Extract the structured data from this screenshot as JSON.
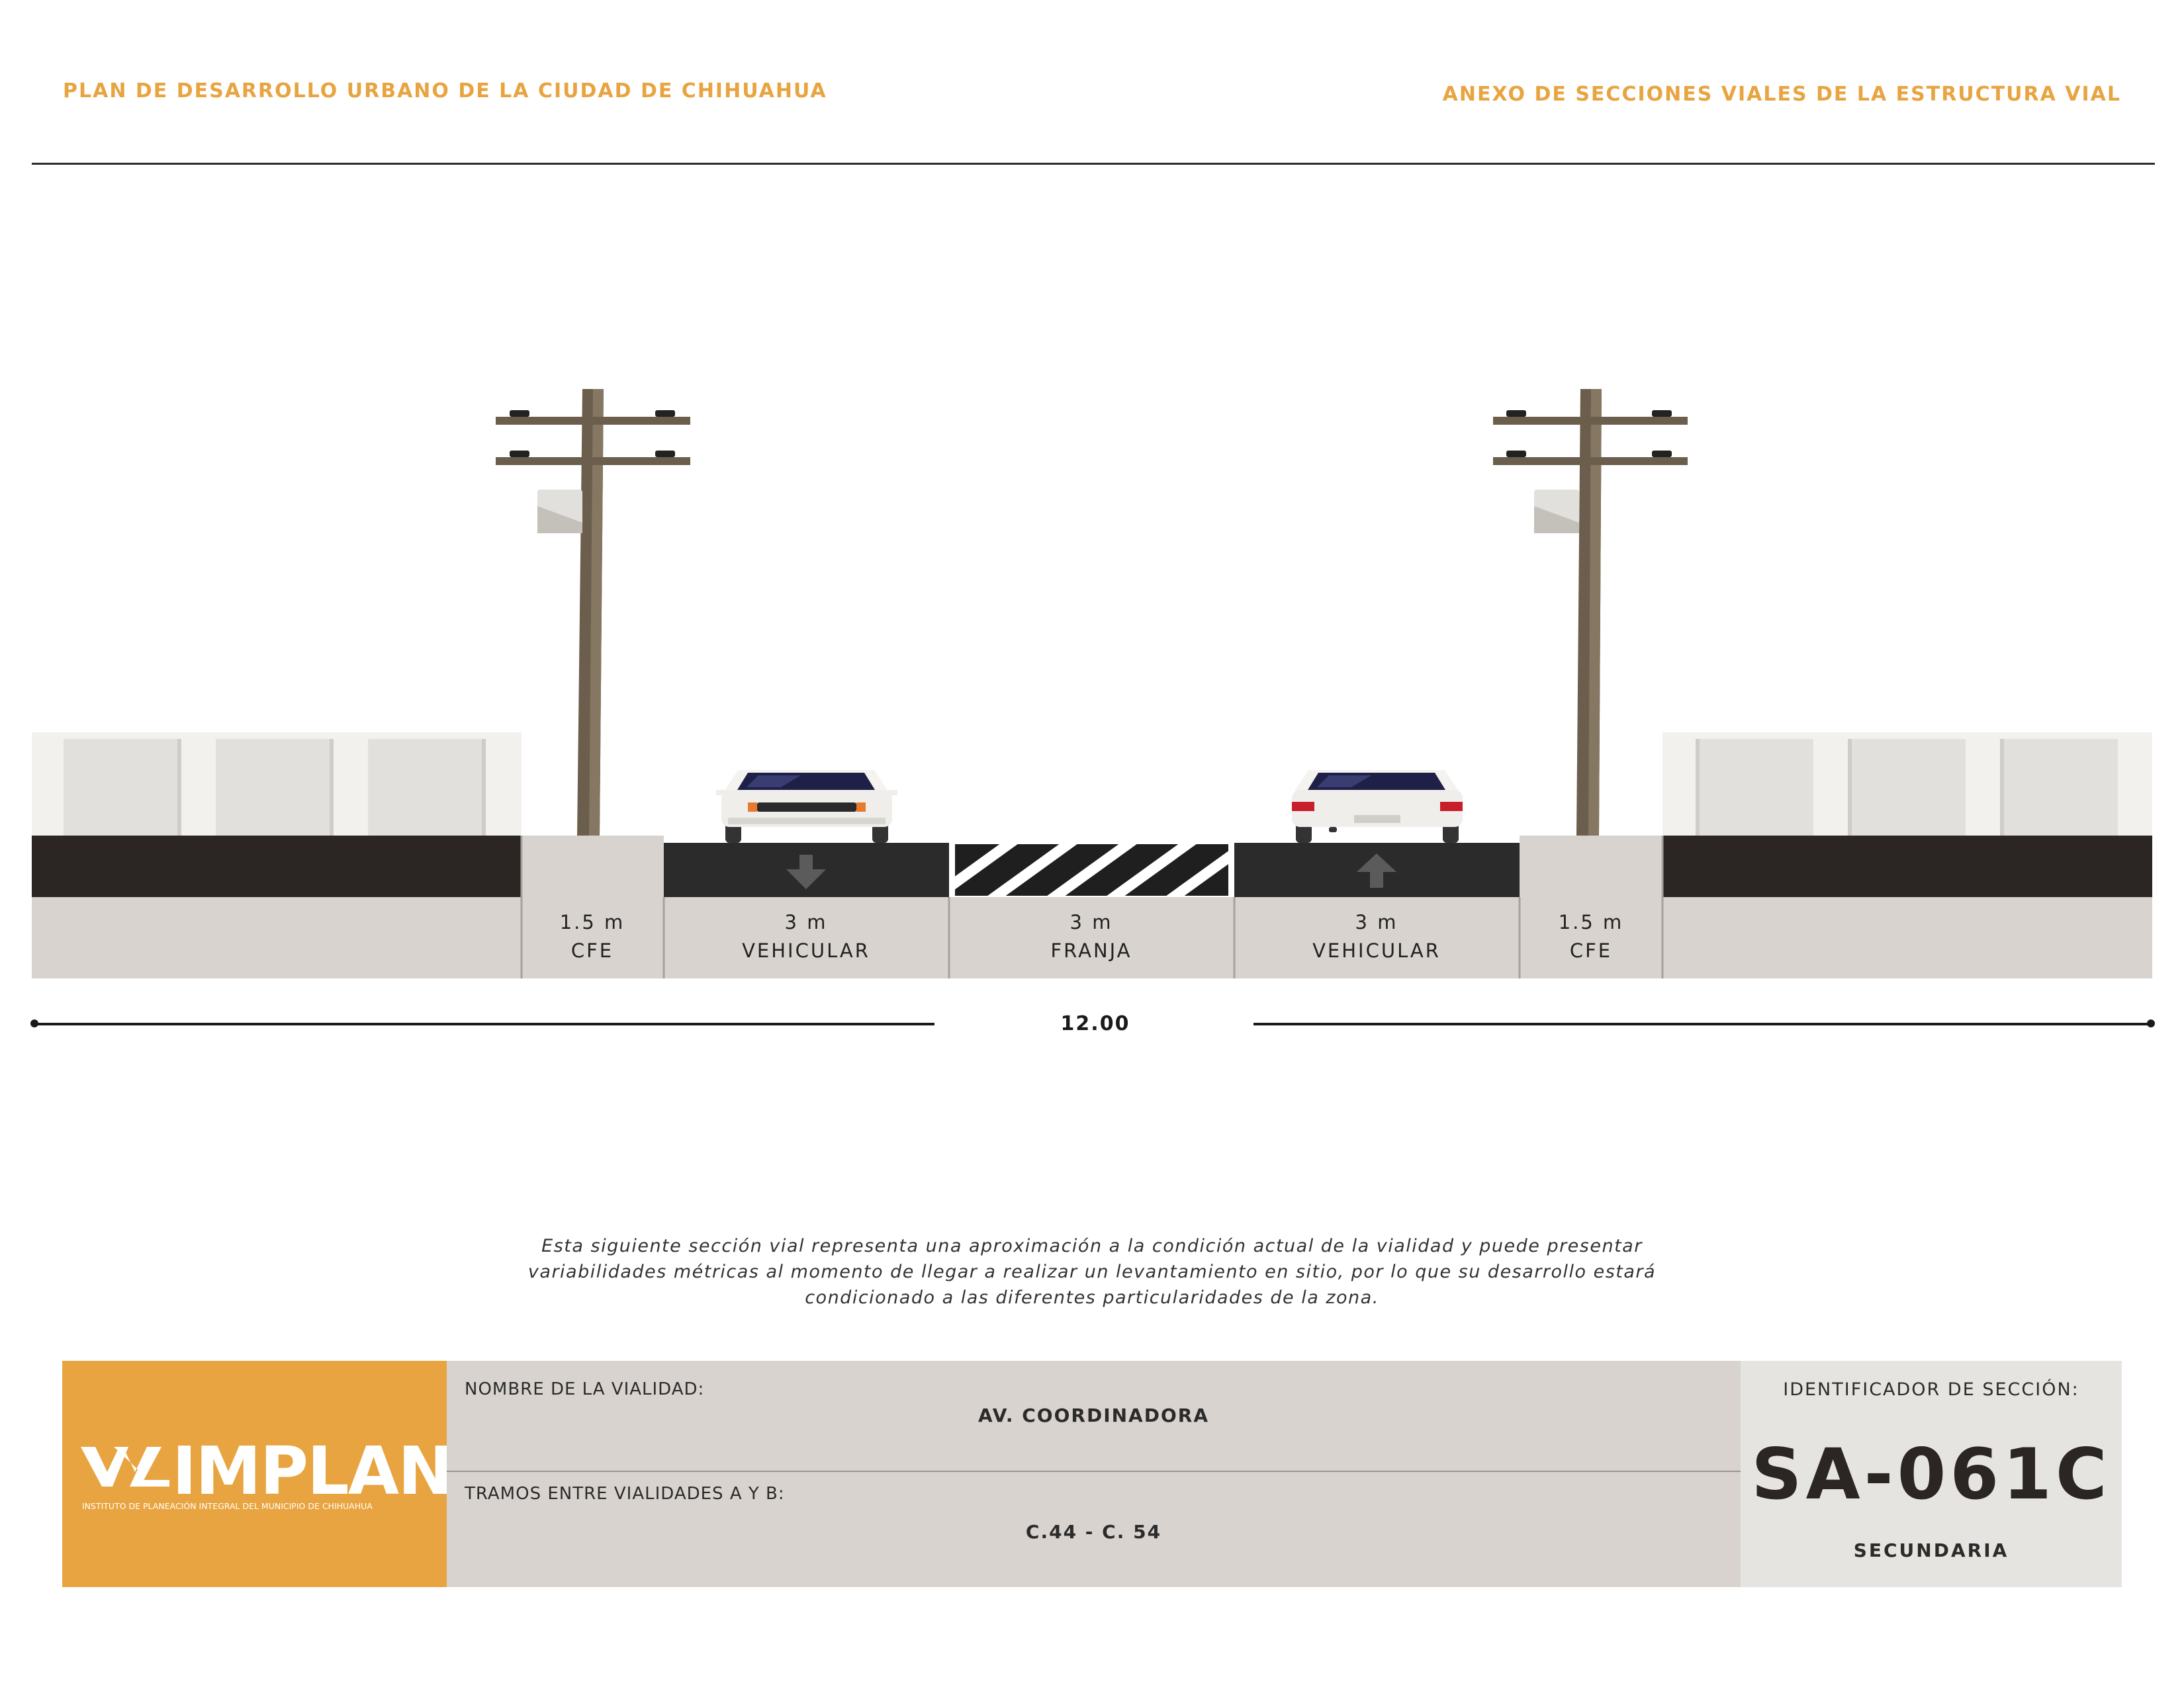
{
  "header": {
    "left_title": "PLAN DE DESARROLLO URBANO DE LA CIUDAD DE CHIHUAHUA",
    "right_title": "ANEXO DE SECCIONES VIALES DE LA ESTRUCTURA VIAL"
  },
  "section": {
    "segments": [
      {
        "width": "1.5 m",
        "use": "CFE"
      },
      {
        "width": "3 m",
        "use": "VEHICULAR",
        "direction": "down"
      },
      {
        "width": "3 m",
        "use": "FRANJA"
      },
      {
        "width": "3 m",
        "use": "VEHICULAR",
        "direction": "up"
      },
      {
        "width": "1.5 m",
        "use": "CFE"
      }
    ],
    "total_width": "12.00"
  },
  "disclaimer": "Esta siguiente sección vial representa una aproximación a la condición actual de la vialidad y puede presentar variabilidades métricas al momento de llegar a realizar un levantamiento en sitio, por lo que su desarrollo estará condicionado a las diferentes particularidades de la zona.",
  "title_block": {
    "logo_word": "IMPLAN",
    "logo_subtitle": "INSTITUTO DE PLANEACIÓN INTEGRAL DEL MUNICIPIO DE CHIHUAHUA",
    "name_label": "NOMBRE DE LA VIALIDAD:",
    "name_value": "AV. COORDINADORA",
    "tramos_label": "TRAMOS ENTRE VIALIDADES A Y B:",
    "tramos_value": "C.44 - C. 54",
    "id_label": "IDENTIFICADOR DE SECCIÓN:",
    "id_code": "SA-061C",
    "id_type": "SECUNDARIA"
  },
  "colors": {
    "accent": "#e8a440",
    "asphalt": "#2a2b2a",
    "ground": "#d8d3ce",
    "pole": "#6b5e4c"
  }
}
